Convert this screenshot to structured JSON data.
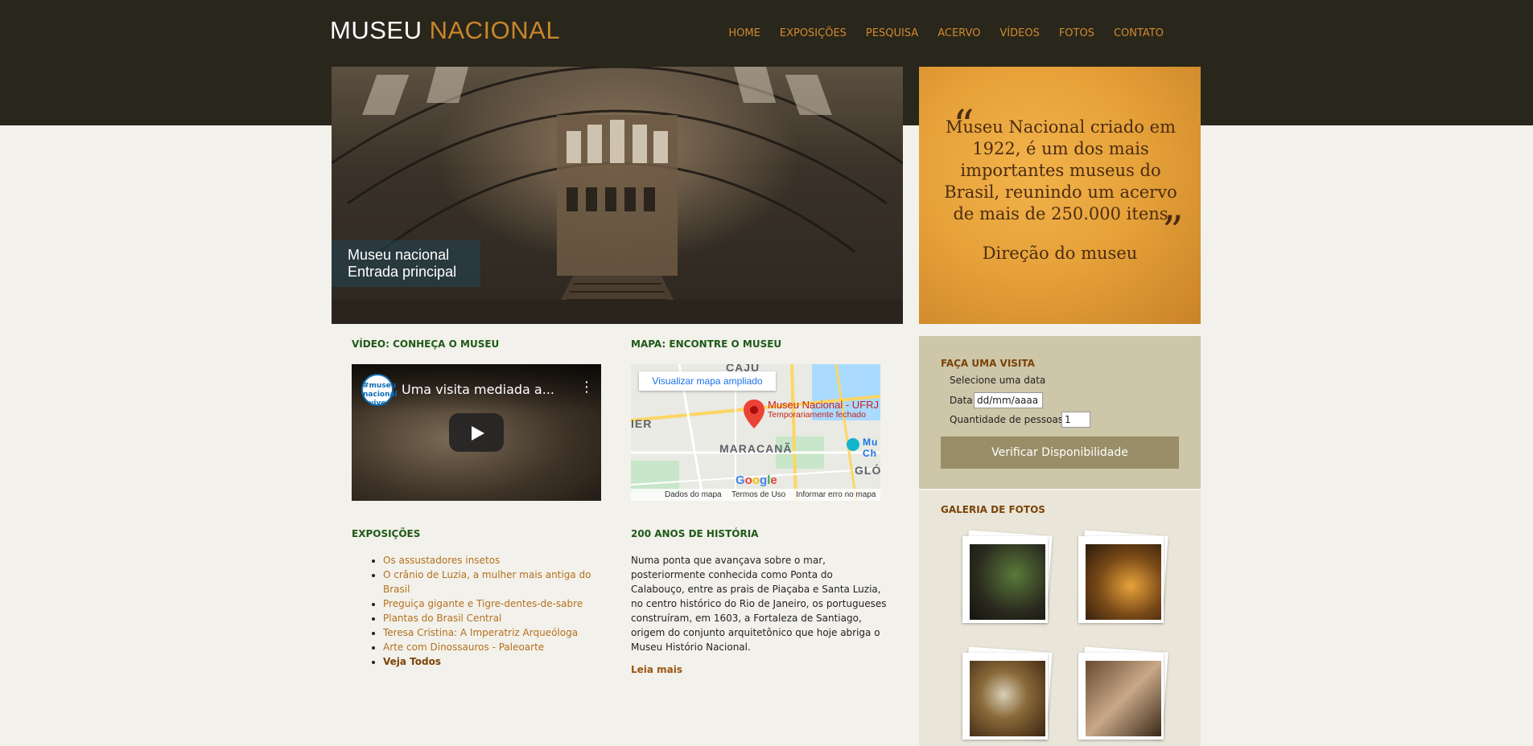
{
  "header": {
    "logo_part1": "MUSEU",
    "logo_part2": "NACIONAL",
    "nav": [
      "HOME",
      "EXPOSIÇÕES",
      "PESQUISA",
      "ACERVO",
      "VÍDEOS",
      "FOTOS",
      "CONTATO"
    ]
  },
  "hero": {
    "caption_line1": "Museu nacional",
    "caption_line2": "Entrada principal"
  },
  "quote": {
    "open_mark": "“",
    "close_mark": "”",
    "text": "Museu Nacional criado em 1922, é um dos mais importantes museus do Brasil, reunindo um acervo de mais de 250.000 itens",
    "author": "Direção do museu"
  },
  "video": {
    "section_title": "VÍDEO: CONHEÇA O MUSEU",
    "title": "Uma visita mediada a...",
    "channel_badge": "#museu nacional vive"
  },
  "map": {
    "section_title": "MAPA: ENCONTRE O MUSEU",
    "enlarge_link": "Visualizar mapa ampliado",
    "place_name": "Museu Nacional - UFRJ",
    "place_status": "Temporariamente fechado",
    "labels": [
      "CAJU",
      "IER",
      "MARACANÃ",
      "GLÓ",
      "Mu",
      "Ch"
    ],
    "logo": "Google",
    "footer_data": "Dados do mapa",
    "footer_terms": "Termos de Uso",
    "footer_report": "Informar erro no mapa"
  },
  "exhibitions": {
    "section_title": "EXPOSIÇÕES",
    "items": [
      "Os assustadores insetos",
      "O crânio de Luzia, a mulher mais antiga do Brasil",
      "Preguiça gigante e Tigre-dentes-de-sabre",
      "Plantas do Brasil Central",
      "Teresa Cristina: A Imperatriz Arqueóloga",
      "Arte com Dinossauros - Paleoarte"
    ],
    "see_all": "Veja Todos"
  },
  "history": {
    "section_title": "200 ANOS DE HISTÓRIA",
    "text": "Numa ponta que avançava sobre o mar, posteriormente conhecida como Ponta do Calabouço, entre as prais de Piaçaba e Santa Luzia, no centro histórico do Rio de Janeiro, os portugueses construíram, em 1603, a Fortaleza de Santiago, origem do conjunto arquitetônico que hoje abriga o Museu Histório Nacional.",
    "read_more": "Leia mais"
  },
  "visit": {
    "section_title": "FAÇA UMA VISITA",
    "instruction": "Selecione uma data",
    "date_label": "Data",
    "date_placeholder": "dd/mm/aaaa",
    "people_label": "Quantidade de pessoas",
    "people_value": "1",
    "button_label": "Verificar Disponibilidade"
  },
  "gallery": {
    "section_title": "GALERIA DE FOTOS"
  },
  "colors": {
    "header_bg": "#29261b",
    "accent": "#c8862b",
    "section_green": "#1d5a17",
    "link": "#b4701e",
    "visit_bg": "#cdc6a8",
    "button": "#9a8e68"
  }
}
